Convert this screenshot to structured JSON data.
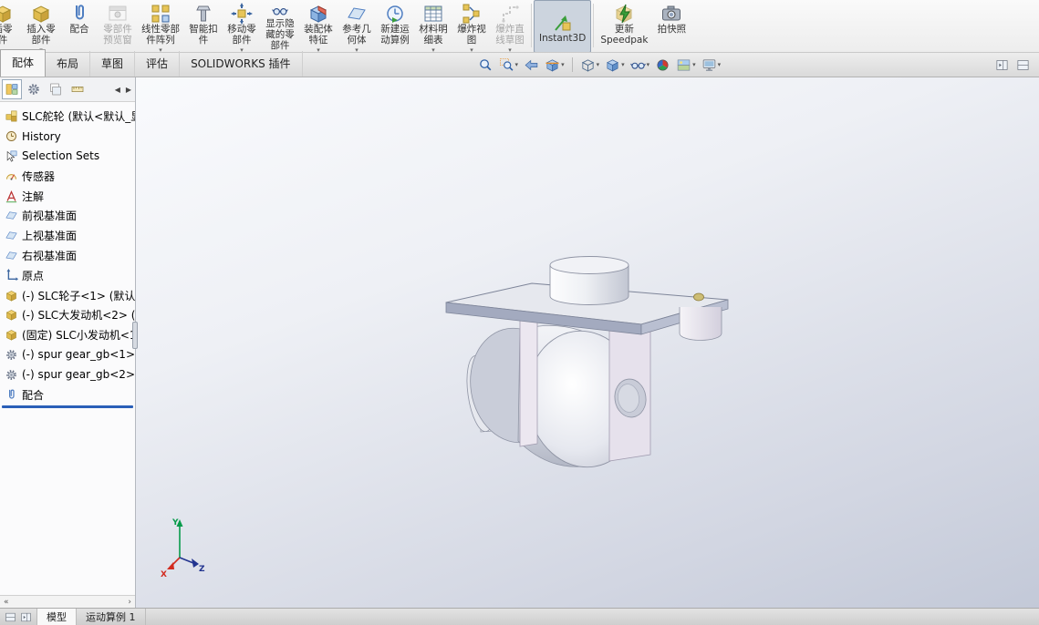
{
  "colors": {
    "accent_blue": "#2a5fb8",
    "ribbon_active_bg": "#ccd4de",
    "viewport_top": "#fbfcfe",
    "viewport_bottom": "#c3c9d8"
  },
  "ribbon": {
    "items": [
      {
        "label": "插零\n件"
      },
      {
        "label": "插入零\n部件",
        "dropdown": true
      },
      {
        "label": "配合"
      },
      {
        "label": "零部件\n预览窗",
        "disabled": true
      },
      {
        "label": "线性零部\n件阵列",
        "dropdown": true
      },
      {
        "label": "智能扣\n件"
      },
      {
        "label": "移动零\n部件",
        "dropdown": true
      },
      {
        "label": "显示隐\n藏的零\n部件"
      },
      {
        "label": "装配体\n特征",
        "dropdown": true
      },
      {
        "label": "参考几\n何体",
        "dropdown": true
      },
      {
        "label": "新建运\n动算例"
      },
      {
        "label": "材料明\n细表",
        "dropdown": true
      },
      {
        "label": "爆炸视\n图",
        "dropdown": true
      },
      {
        "label": "爆炸直\n线草图",
        "disabled": true,
        "dropdown": true
      },
      {
        "label": "Instant3D",
        "active": true
      },
      {
        "label": "更新\nSpeedpak"
      },
      {
        "label": "拍快照"
      }
    ],
    "dropdown_glyph": "▾"
  },
  "command_tabs": {
    "items": [
      {
        "label": "配体",
        "active": true
      },
      {
        "label": "布局"
      },
      {
        "label": "草图"
      },
      {
        "label": "评估"
      },
      {
        "label": "SOLIDWORKS 插件"
      }
    ]
  },
  "view_toolbar": {
    "icons": [
      "zoom-to-fit",
      "zoom-to-area",
      "previous-view",
      "section-view",
      "view-orientation",
      "display-style",
      "hide-show-items",
      "edit-appearance",
      "apply-scene",
      "view-settings"
    ]
  },
  "left_panel": {
    "tabs": [
      "featuremanager-design-tree",
      "propertymanager",
      "configuration-manager",
      "dimxpert-manager"
    ],
    "scroll_left_glyph": "◀",
    "scroll_right_glyph": "▶",
    "foot_left_glyph": "«",
    "foot_right_glyph": "›",
    "tree": {
      "items": [
        {
          "label": "SLC舵轮 (默认<默认_显示",
          "icon": "assembly"
        },
        {
          "label": "History",
          "icon": "history"
        },
        {
          "label": "Selection Sets",
          "icon": "selection-sets"
        },
        {
          "label": "传感器",
          "icon": "sensors"
        },
        {
          "label": "注解",
          "icon": "annotations"
        },
        {
          "label": "前视基准面",
          "icon": "plane"
        },
        {
          "label": "上视基准面",
          "icon": "plane"
        },
        {
          "label": "右视基准面",
          "icon": "plane"
        },
        {
          "label": "原点",
          "icon": "origin"
        },
        {
          "label": "(-) SLC轮子<1> (默认",
          "icon": "component"
        },
        {
          "label": "(-) SLC大发动机<2> (",
          "icon": "component"
        },
        {
          "label": "(固定) SLC小发动机<1",
          "icon": "component"
        },
        {
          "label": "(-) spur gear_gb<1>",
          "icon": "toolbox-component"
        },
        {
          "label": "(-) spur gear_gb<2>",
          "icon": "toolbox-component"
        },
        {
          "label": "配合",
          "icon": "mates",
          "selected": true
        }
      ]
    }
  },
  "viewport": {
    "triad": {
      "x_label": "X",
      "y_label": "Y",
      "z_label": "Z"
    }
  },
  "bottom_bar": {
    "tabs": [
      {
        "label": "模型",
        "active": true
      },
      {
        "label": "运动算例 1"
      }
    ]
  }
}
